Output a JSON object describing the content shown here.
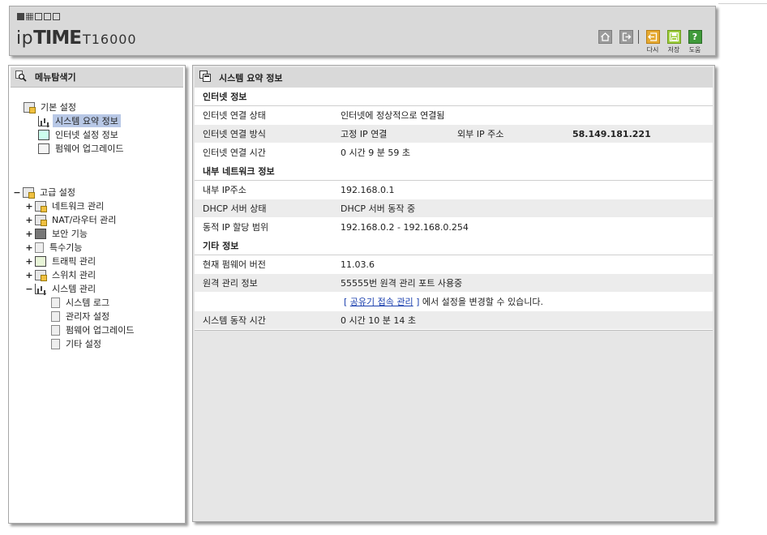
{
  "header": {
    "logo": {
      "brand_ip": "ip",
      "brand_time": "TIME",
      "model": "T16000"
    },
    "buttons": [
      {
        "name": "home-icon",
        "label": ""
      },
      {
        "name": "logout-icon",
        "label": ""
      },
      {
        "name": "back-icon",
        "label": "다시"
      },
      {
        "name": "save-icon",
        "label": "저장"
      },
      {
        "name": "help-icon",
        "label": "도움"
      }
    ],
    "help_glyph": "?"
  },
  "sidebar": {
    "title": "메뉴탐색기",
    "basic": {
      "label": "기본 설정",
      "items": [
        {
          "label": "시스템 요약 정보",
          "selected": true
        },
        {
          "label": "인터넷 설정 정보",
          "selected": false
        },
        {
          "label": "펌웨어 업그레이드",
          "selected": false
        }
      ]
    },
    "advanced": {
      "toggle": "−",
      "label": "고급 설정",
      "items": [
        {
          "toggle": "+",
          "label": "네트워크 관리"
        },
        {
          "toggle": "+",
          "label": "NAT/라우터 관리"
        },
        {
          "toggle": "+",
          "label": "보안 기능"
        },
        {
          "toggle": "+",
          "label": "특수기능"
        },
        {
          "toggle": "+",
          "label": "트래픽 관리"
        },
        {
          "toggle": "+",
          "label": "스위치 관리"
        },
        {
          "toggle": "−",
          "label": "시스템 관리"
        }
      ],
      "system_items": [
        {
          "label": "시스템 로그"
        },
        {
          "label": "관리자 설정"
        },
        {
          "label": "펌웨어 업그레이드"
        },
        {
          "label": "기타 설정"
        }
      ]
    }
  },
  "main": {
    "title": "시스템 요약 정보",
    "internet": {
      "heading": "인터넷 정보",
      "status_label": "인터넷 연결 상태",
      "status_value": "인터넷에 정상적으로 연결됨",
      "method_label": "인터넷 연결 방식",
      "method_value": "고정 IP 연결",
      "external_ip_label": "외부 IP 주소",
      "external_ip_value": "58.149.181.221",
      "uptime_label": "인터넷 연결 시간",
      "uptime_value": "0 시간 9 분 59 초"
    },
    "lan": {
      "heading": "내부 네트워크 정보",
      "ip_label": "내부 IP주소",
      "ip_value": "192.168.0.1",
      "dhcp_label": "DHCP 서버 상태",
      "dhcp_value": "DHCP 서버 동작 중",
      "range_label": "동적 IP 할당 범위",
      "range_value": "192.168.0.2 -  192.168.0.254"
    },
    "other": {
      "heading": "기타 정보",
      "fw_label": "현재 펌웨어 버전",
      "fw_value": "11.03.6",
      "remote_label": "원격 관리 정보",
      "remote_value": "55555번 원격 관리 포트 사용중",
      "remote_link_prefix": "[ ",
      "remote_link": "공유기 접속 관리",
      "remote_link_suffix": " ]",
      "remote_link_note": " 에서 설정을 변경할 수 있습니다.",
      "sys_uptime_label": "시스템 동작 시간",
      "sys_uptime_value": "0 시간 10 분 14 초"
    }
  }
}
